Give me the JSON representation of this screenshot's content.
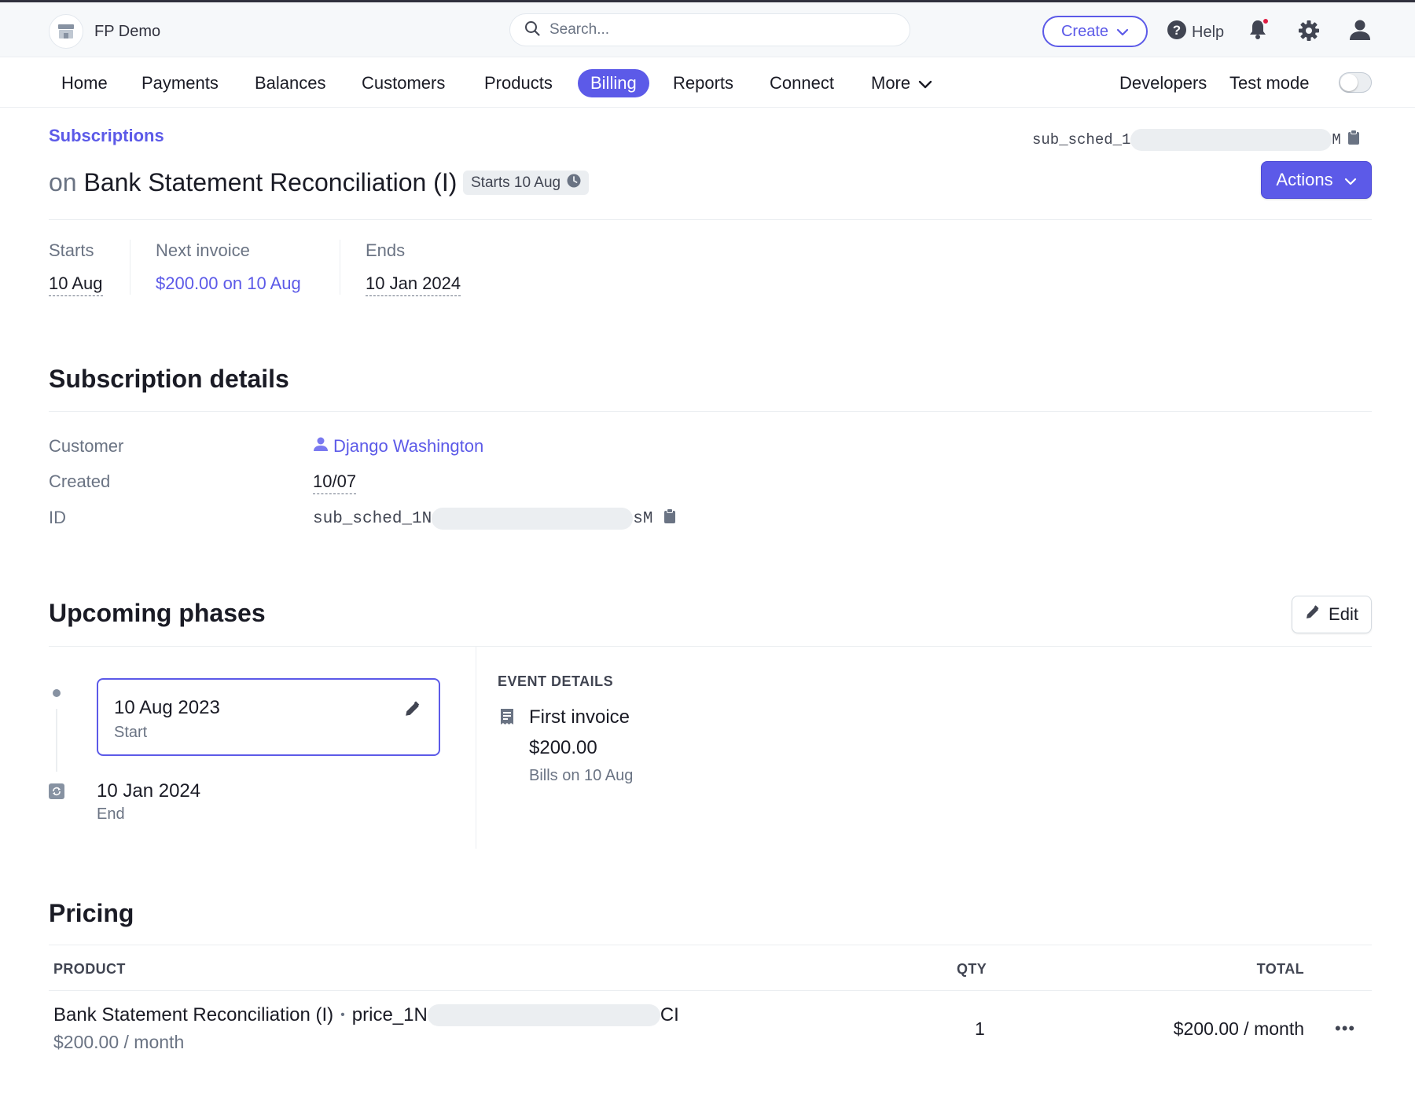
{
  "topbar": {
    "account_name": "FP Demo",
    "search_placeholder": "Search...",
    "create_label": "Create",
    "help_label": "Help"
  },
  "nav": {
    "items": [
      "Home",
      "Payments",
      "Balances",
      "Customers",
      "Products",
      "Billing",
      "Reports",
      "Connect",
      "More"
    ],
    "active": "Billing",
    "developers_label": "Developers",
    "test_mode_label": "Test mode",
    "test_mode_on": false
  },
  "header": {
    "breadcrumb": "Subscriptions",
    "id_prefix": "sub_sched_1",
    "id_suffix": "M",
    "title_prefix": "on",
    "title": "Bank Statement Reconciliation (I)",
    "badge": "Starts 10 Aug",
    "actions_label": "Actions"
  },
  "summary": {
    "starts_label": "Starts",
    "starts_value": "10 Aug",
    "next_invoice_label": "Next invoice",
    "next_invoice_value": "$200.00 on 10 Aug",
    "ends_label": "Ends",
    "ends_value": "10 Jan 2024"
  },
  "subscription_details": {
    "title": "Subscription details",
    "customer_label": "Customer",
    "customer_value": "Django Washington",
    "created_label": "Created",
    "created_value": "10/07",
    "id_label": "ID",
    "id_prefix": "sub_sched_1N",
    "id_suffix": "sM"
  },
  "upcoming_phases": {
    "title": "Upcoming phases",
    "edit_label": "Edit",
    "start_date": "10 Aug 2023",
    "start_label": "Start",
    "end_date": "10 Jan 2024",
    "end_label": "End",
    "event_header": "EVENT DETAILS",
    "event_title": "First invoice",
    "event_amount": "$200.00",
    "event_sub": "Bills on 10 Aug"
  },
  "pricing": {
    "title": "Pricing",
    "col_product": "PRODUCT",
    "col_qty": "QTY",
    "col_total": "TOTAL",
    "rows": [
      {
        "product": "Bank Statement Reconciliation (I)",
        "separator": "•",
        "price_prefix": "price_1N",
        "price_suffix": "CI",
        "unit": "$200.00 / month",
        "qty": "1",
        "total": "$200.00 / month",
        "more": "•••"
      }
    ]
  },
  "colors": {
    "accent": "#5c5ae8",
    "text": "#1a1b25",
    "muted": "#6a7383",
    "notification": "#df1b41"
  }
}
